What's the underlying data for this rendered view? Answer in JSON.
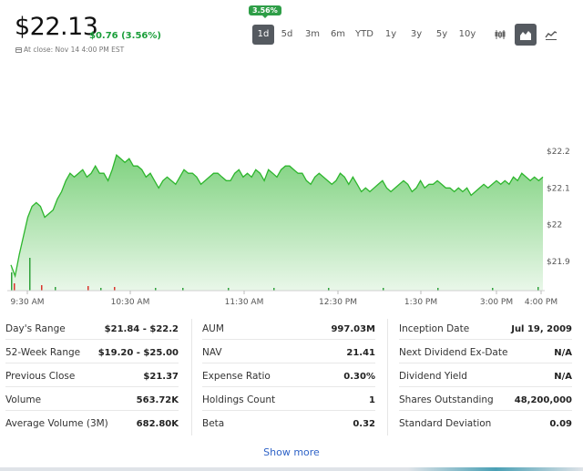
{
  "quote": {
    "price": "$22.13",
    "change": "$0.76 (3.56%)",
    "close_info": "At close: Nov 14 4:00 PM EST",
    "badge": "3.56%"
  },
  "ranges": [
    "1d",
    "5d",
    "3m",
    "6m",
    "YTD",
    "1y",
    "3y",
    "5y",
    "10y"
  ],
  "active_range": "1d",
  "chart_types": [
    "candlestick-icon",
    "area-chart-icon",
    "line-chart-icon"
  ],
  "active_chart_type": "area-chart-icon",
  "chart_data": {
    "type": "area",
    "x_ticks": [
      "9:30 AM",
      "10:30 AM",
      "11:30 AM",
      "12:30 PM",
      "1:30 PM",
      "3:00 PM",
      "4:00 PM"
    ],
    "y_ticks": [
      "$22.2",
      "$22.1",
      "$22",
      "$21.9"
    ],
    "ylim": [
      21.82,
      22.24
    ],
    "grid": false,
    "colors": {
      "line": "#2db62d",
      "fill_top": "#7fd27f",
      "fill_bottom": "#e9f7e9",
      "volume_up": "#2fa13b",
      "volume_down": "#d9342b"
    },
    "series": [
      {
        "values": [
          21.89,
          21.86,
          21.92,
          21.97,
          22.02,
          22.05,
          22.06,
          22.05,
          22.02,
          22.03,
          22.04,
          22.07,
          22.09,
          22.12,
          22.14,
          22.13,
          22.14,
          22.15,
          22.13,
          22.14,
          22.16,
          22.14,
          22.14,
          22.12,
          22.15,
          22.19,
          22.18,
          22.17,
          22.18,
          22.16,
          22.16,
          22.15,
          22.13,
          22.14,
          22.12,
          22.1,
          22.12,
          22.13,
          22.12,
          22.11,
          22.13,
          22.15,
          22.14,
          22.14,
          22.13,
          22.11,
          22.12,
          22.13,
          22.14,
          22.14,
          22.13,
          22.12,
          22.12,
          22.14,
          22.15,
          22.13,
          22.14,
          22.13,
          22.15,
          22.14,
          22.12,
          22.15,
          22.14,
          22.13,
          22.15,
          22.16,
          22.16,
          22.15,
          22.14,
          22.14,
          22.12,
          22.11,
          22.13,
          22.14,
          22.13,
          22.12,
          22.11,
          22.12,
          22.14,
          22.13,
          22.11,
          22.13,
          22.11,
          22.09,
          22.1,
          22.09,
          22.1,
          22.11,
          22.12,
          22.1,
          22.09,
          22.1,
          22.11,
          22.12,
          22.11,
          22.09,
          22.1,
          22.12,
          22.1,
          22.11,
          22.11,
          22.12,
          22.11,
          22.1,
          22.1,
          22.09,
          22.1,
          22.09,
          22.1,
          22.08,
          22.09,
          22.1,
          22.11,
          22.1,
          22.11,
          22.12,
          22.11,
          22.12,
          22.11,
          22.13,
          22.12,
          22.14,
          22.13,
          22.12,
          22.13,
          22.12,
          22.13
        ]
      }
    ]
  },
  "stats": {
    "col1": [
      {
        "label": "Day's Range",
        "value": "$21.84 - $22.2"
      },
      {
        "label": "52-Week Range",
        "value": "$19.20 - $25.00"
      },
      {
        "label": "Previous Close",
        "value": "$21.37"
      },
      {
        "label": "Volume",
        "value": "563.72K"
      },
      {
        "label": "Average Volume (3M)",
        "value": "682.80K"
      }
    ],
    "col2": [
      {
        "label": "AUM",
        "value": "997.03M"
      },
      {
        "label": "NAV",
        "value": "21.41"
      },
      {
        "label": "Expense Ratio",
        "value": "0.30%"
      },
      {
        "label": "Holdings Count",
        "value": "1"
      },
      {
        "label": "Beta",
        "value": "0.32"
      }
    ],
    "col3": [
      {
        "label": "Inception Date",
        "value": "Jul 19, 2009"
      },
      {
        "label": "Next Dividend Ex-Date",
        "value": "N/A"
      },
      {
        "label": "Dividend Yield",
        "value": "N/A"
      },
      {
        "label": "Shares Outstanding",
        "value": "48,200,000"
      },
      {
        "label": "Standard Deviation",
        "value": "0.09"
      }
    ]
  },
  "show_more": "Show more"
}
